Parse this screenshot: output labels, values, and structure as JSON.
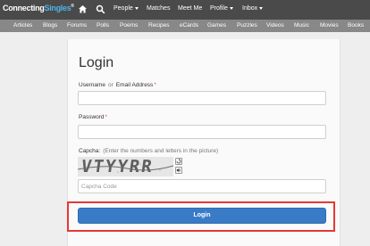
{
  "site": {
    "logo_main": "Connecting",
    "logo_accent": "Singles",
    "logo_mark": "®"
  },
  "top_nav": {
    "home_icon": "home-icon",
    "search_icon": "search-icon",
    "items": [
      {
        "label": "People",
        "dropdown": true
      },
      {
        "label": "Matches",
        "dropdown": false
      },
      {
        "label": "Meet Me",
        "dropdown": false
      },
      {
        "label": "Profile",
        "dropdown": true
      },
      {
        "label": "Inbox",
        "dropdown": true
      }
    ]
  },
  "sub_nav": {
    "items": [
      "Articles",
      "Blogs",
      "Forums",
      "Polls",
      "Poems",
      "Recipes",
      "eCards",
      "Games",
      "Puzzles",
      "Videos",
      "Music",
      "Movies",
      "Books"
    ]
  },
  "login_form": {
    "title": "Login",
    "username_label": "Username",
    "or_text": "or",
    "email_label": "Email Address",
    "required_mark": "*",
    "password_label": "Password",
    "captcha_label": "Capcha:",
    "captcha_hint": "(Enter the numbers and letters in the picture)",
    "captcha_image_text": "VTYYRR",
    "captcha_placeholder": "Capcha Code",
    "submit_label": "Login"
  },
  "colors": {
    "topbar": "#4a4a4a",
    "subbar": "#888888",
    "accent": "#4fb3e8",
    "button": "#3a7bc8",
    "highlight": "#e53935"
  }
}
